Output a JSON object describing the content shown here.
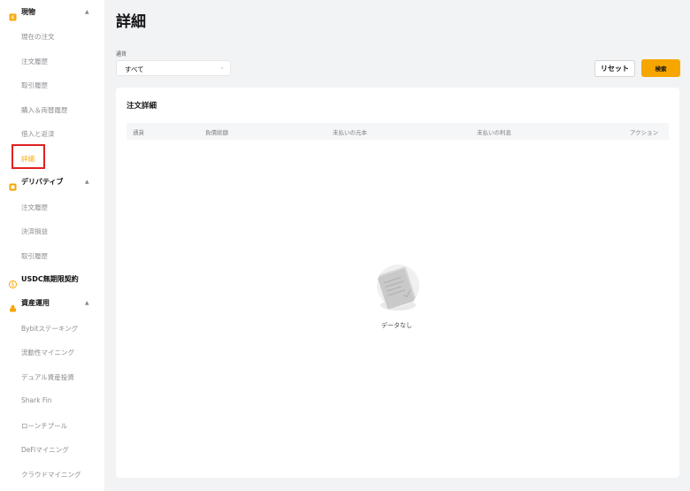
{
  "sidebar": {
    "spot": {
      "label": "現物",
      "icon": "spot-coin-icon"
    },
    "spot_items": [
      "現在の注文",
      "注文履歴",
      "取引履歴",
      "購入＆両替履歴",
      "借入と返済",
      "詳細"
    ],
    "derivatives": {
      "label": "デリバティブ",
      "icon": "derivatives-icon"
    },
    "derivatives_items": [
      "注文履歴",
      "決済損益",
      "取引履歴"
    ],
    "usdc": {
      "label": "USDC無期限契約",
      "icon": "usdc-icon"
    },
    "asset": {
      "label": "資産運用",
      "icon": "asset-management-icon"
    },
    "asset_items": [
      "Bybitステーキング",
      "流動性マイニング",
      "デュアル資産投資",
      "Shark Fin",
      "ローンチプール",
      "DeFiマイニング",
      "クラウドマイニング"
    ]
  },
  "page": {
    "title": "詳細"
  },
  "filter": {
    "currency_label": "通貨",
    "currency_value": "すべて",
    "reset_label": "リセット",
    "search_label": "検索"
  },
  "card": {
    "title": "注文詳細",
    "columns": [
      "通貨",
      "負債総額",
      "未払いの元本",
      "未払いの利息",
      "アクション"
    ],
    "empty_text": "データなし"
  },
  "colors": {
    "accent": "#f7a600",
    "highlight": "#e02020"
  }
}
